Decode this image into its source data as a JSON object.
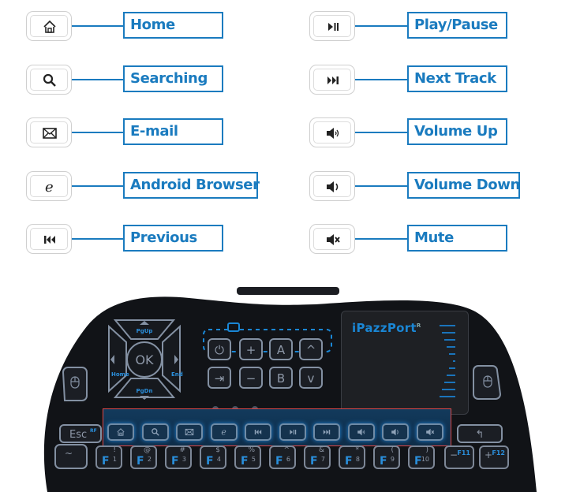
{
  "legend": {
    "left": [
      {
        "icon": "home-icon",
        "label": "Home"
      },
      {
        "icon": "search-icon",
        "label": "Searching"
      },
      {
        "icon": "mail-icon",
        "label": "E-mail"
      },
      {
        "icon": "browser-e-icon",
        "label": "Android Browser"
      },
      {
        "icon": "previous-track-icon",
        "label": "Previous"
      }
    ],
    "right": [
      {
        "icon": "play-pause-icon",
        "label": "Play/Pause"
      },
      {
        "icon": "next-track-icon",
        "label": "Next Track"
      },
      {
        "icon": "volume-up-icon",
        "label": "Volume Up"
      },
      {
        "icon": "volume-down-icon",
        "label": "Volume Down"
      },
      {
        "icon": "mute-icon",
        "label": "Mute"
      }
    ]
  },
  "keyboard": {
    "brand": "iPazzPort",
    "brand_mark": "R",
    "dpad": {
      "up": "PgUp",
      "down": "PgDn",
      "left": "Home",
      "right": "End",
      "center": "OK"
    },
    "tv_keys": [
      "⏻",
      "+",
      "A",
      "^",
      "⇥",
      "−",
      "B",
      "v"
    ],
    "esc": {
      "label": "Esc",
      "sub": "RF"
    },
    "media_row": [
      "home",
      "search",
      "mail",
      "browser",
      "previous",
      "play-pause",
      "next",
      "volume-up",
      "volume-down",
      "mute"
    ],
    "fkeys": [
      {
        "f": "F",
        "num": "1",
        "sym": "!"
      },
      {
        "f": "F",
        "num": "2",
        "sym": "@"
      },
      {
        "f": "F",
        "num": "3",
        "sym": "#"
      },
      {
        "f": "F",
        "num": "4",
        "sym": "$"
      },
      {
        "f": "F",
        "num": "5",
        "sym": "%"
      },
      {
        "f": "F",
        "num": "6",
        "sym": "^"
      },
      {
        "f": "F",
        "num": "7",
        "sym": "&"
      },
      {
        "f": "F",
        "num": "8",
        "sym": "*"
      },
      {
        "f": "F",
        "num": "9",
        "sym": "("
      },
      {
        "f": "F",
        "num": "10",
        "sym": ")"
      }
    ],
    "f11": {
      "sign": "−",
      "label": "F11"
    },
    "f12": {
      "sign": "+",
      "label": "F12"
    }
  },
  "colors": {
    "accent": "#1a7bbf",
    "keyboard_body": "#111317",
    "key_outline": "#7d8797",
    "highlight": "#e04848"
  }
}
